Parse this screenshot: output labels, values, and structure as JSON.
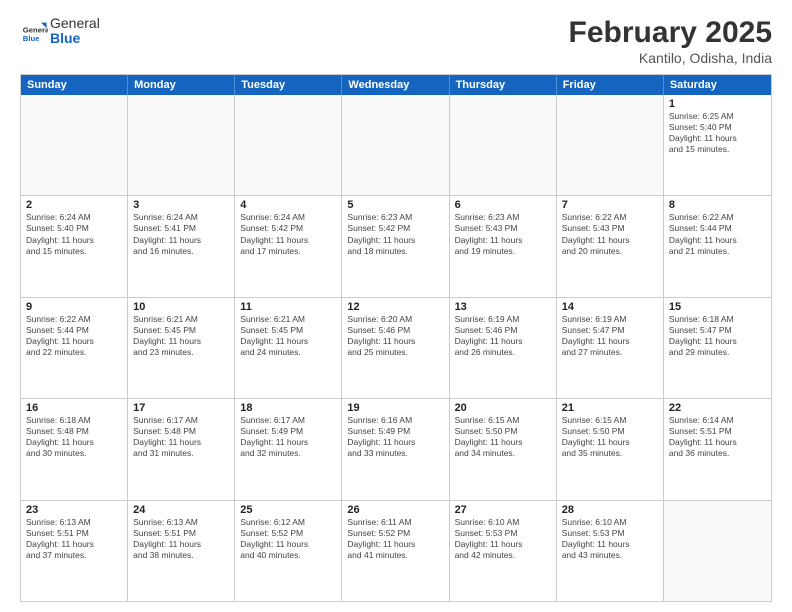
{
  "logo": {
    "general": "General",
    "blue": "Blue"
  },
  "header": {
    "title": "February 2025",
    "location": "Kantilo, Odisha, India"
  },
  "days": [
    "Sunday",
    "Monday",
    "Tuesday",
    "Wednesday",
    "Thursday",
    "Friday",
    "Saturday"
  ],
  "weeks": [
    [
      {
        "date": "",
        "info": ""
      },
      {
        "date": "",
        "info": ""
      },
      {
        "date": "",
        "info": ""
      },
      {
        "date": "",
        "info": ""
      },
      {
        "date": "",
        "info": ""
      },
      {
        "date": "",
        "info": ""
      },
      {
        "date": "1",
        "info": "Sunrise: 6:25 AM\nSunset: 5:40 PM\nDaylight: 11 hours\nand 15 minutes."
      }
    ],
    [
      {
        "date": "2",
        "info": "Sunrise: 6:24 AM\nSunset: 5:40 PM\nDaylight: 11 hours\nand 15 minutes."
      },
      {
        "date": "3",
        "info": "Sunrise: 6:24 AM\nSunset: 5:41 PM\nDaylight: 11 hours\nand 16 minutes."
      },
      {
        "date": "4",
        "info": "Sunrise: 6:24 AM\nSunset: 5:42 PM\nDaylight: 11 hours\nand 17 minutes."
      },
      {
        "date": "5",
        "info": "Sunrise: 6:23 AM\nSunset: 5:42 PM\nDaylight: 11 hours\nand 18 minutes."
      },
      {
        "date": "6",
        "info": "Sunrise: 6:23 AM\nSunset: 5:43 PM\nDaylight: 11 hours\nand 19 minutes."
      },
      {
        "date": "7",
        "info": "Sunrise: 6:22 AM\nSunset: 5:43 PM\nDaylight: 11 hours\nand 20 minutes."
      },
      {
        "date": "8",
        "info": "Sunrise: 6:22 AM\nSunset: 5:44 PM\nDaylight: 11 hours\nand 21 minutes."
      }
    ],
    [
      {
        "date": "9",
        "info": "Sunrise: 6:22 AM\nSunset: 5:44 PM\nDaylight: 11 hours\nand 22 minutes."
      },
      {
        "date": "10",
        "info": "Sunrise: 6:21 AM\nSunset: 5:45 PM\nDaylight: 11 hours\nand 23 minutes."
      },
      {
        "date": "11",
        "info": "Sunrise: 6:21 AM\nSunset: 5:45 PM\nDaylight: 11 hours\nand 24 minutes."
      },
      {
        "date": "12",
        "info": "Sunrise: 6:20 AM\nSunset: 5:46 PM\nDaylight: 11 hours\nand 25 minutes."
      },
      {
        "date": "13",
        "info": "Sunrise: 6:19 AM\nSunset: 5:46 PM\nDaylight: 11 hours\nand 26 minutes."
      },
      {
        "date": "14",
        "info": "Sunrise: 6:19 AM\nSunset: 5:47 PM\nDaylight: 11 hours\nand 27 minutes."
      },
      {
        "date": "15",
        "info": "Sunrise: 6:18 AM\nSunset: 5:47 PM\nDaylight: 11 hours\nand 29 minutes."
      }
    ],
    [
      {
        "date": "16",
        "info": "Sunrise: 6:18 AM\nSunset: 5:48 PM\nDaylight: 11 hours\nand 30 minutes."
      },
      {
        "date": "17",
        "info": "Sunrise: 6:17 AM\nSunset: 5:48 PM\nDaylight: 11 hours\nand 31 minutes."
      },
      {
        "date": "18",
        "info": "Sunrise: 6:17 AM\nSunset: 5:49 PM\nDaylight: 11 hours\nand 32 minutes."
      },
      {
        "date": "19",
        "info": "Sunrise: 6:16 AM\nSunset: 5:49 PM\nDaylight: 11 hours\nand 33 minutes."
      },
      {
        "date": "20",
        "info": "Sunrise: 6:15 AM\nSunset: 5:50 PM\nDaylight: 11 hours\nand 34 minutes."
      },
      {
        "date": "21",
        "info": "Sunrise: 6:15 AM\nSunset: 5:50 PM\nDaylight: 11 hours\nand 35 minutes."
      },
      {
        "date": "22",
        "info": "Sunrise: 6:14 AM\nSunset: 5:51 PM\nDaylight: 11 hours\nand 36 minutes."
      }
    ],
    [
      {
        "date": "23",
        "info": "Sunrise: 6:13 AM\nSunset: 5:51 PM\nDaylight: 11 hours\nand 37 minutes."
      },
      {
        "date": "24",
        "info": "Sunrise: 6:13 AM\nSunset: 5:51 PM\nDaylight: 11 hours\nand 38 minutes."
      },
      {
        "date": "25",
        "info": "Sunrise: 6:12 AM\nSunset: 5:52 PM\nDaylight: 11 hours\nand 40 minutes."
      },
      {
        "date": "26",
        "info": "Sunrise: 6:11 AM\nSunset: 5:52 PM\nDaylight: 11 hours\nand 41 minutes."
      },
      {
        "date": "27",
        "info": "Sunrise: 6:10 AM\nSunset: 5:53 PM\nDaylight: 11 hours\nand 42 minutes."
      },
      {
        "date": "28",
        "info": "Sunrise: 6:10 AM\nSunset: 5:53 PM\nDaylight: 11 hours\nand 43 minutes."
      },
      {
        "date": "",
        "info": ""
      }
    ]
  ]
}
